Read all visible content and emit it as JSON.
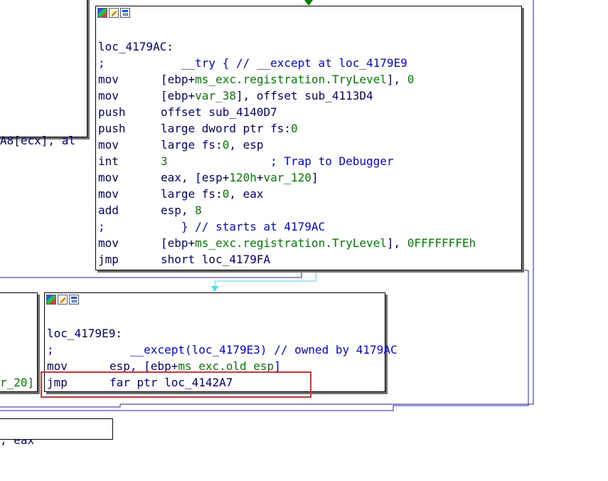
{
  "nodes": {
    "top": {
      "label": "loc_4179AC:",
      "lines": [
        {
          "mnem": ";",
          "ops": [
            {
              "t": "   __try { // __except at loc_4179E9",
              "c": "t-comment"
            }
          ]
        },
        {
          "mnem": "mov",
          "ops": [
            {
              "t": "[ebp+",
              "c": "t-plain"
            },
            {
              "t": "ms_exc.registration.TryLevel",
              "c": "t-var"
            },
            {
              "t": "], ",
              "c": "t-plain"
            },
            {
              "t": "0",
              "c": "t-num"
            }
          ]
        },
        {
          "mnem": "mov",
          "ops": [
            {
              "t": "[ebp+",
              "c": "t-plain"
            },
            {
              "t": "var_38",
              "c": "t-var"
            },
            {
              "t": "], offset sub_4113D4",
              "c": "t-plain"
            }
          ]
        },
        {
          "mnem": "push",
          "ops": [
            {
              "t": "offset sub_4140D7",
              "c": "t-plain"
            }
          ]
        },
        {
          "mnem": "push",
          "ops": [
            {
              "t": "large dword ptr fs:",
              "c": "t-plain"
            },
            {
              "t": "0",
              "c": "t-num"
            }
          ]
        },
        {
          "mnem": "mov",
          "ops": [
            {
              "t": "large fs:",
              "c": "t-plain"
            },
            {
              "t": "0",
              "c": "t-num"
            },
            {
              "t": ", esp",
              "c": "t-plain"
            }
          ]
        },
        {
          "mnem": "int",
          "ops": [
            {
              "t": "3",
              "c": "t-num"
            },
            {
              "t": "               ; Trap to Debugger",
              "c": "t-comment"
            }
          ]
        },
        {
          "mnem": "mov",
          "ops": [
            {
              "t": "eax, [esp+",
              "c": "t-plain"
            },
            {
              "t": "120h",
              "c": "t-num"
            },
            {
              "t": "+",
              "c": "t-plain"
            },
            {
              "t": "var_120",
              "c": "t-var"
            },
            {
              "t": "]",
              "c": "t-plain"
            }
          ]
        },
        {
          "mnem": "mov",
          "ops": [
            {
              "t": "large fs:",
              "c": "t-plain"
            },
            {
              "t": "0",
              "c": "t-num"
            },
            {
              "t": ", eax",
              "c": "t-plain"
            }
          ]
        },
        {
          "mnem": "add",
          "ops": [
            {
              "t": "esp, ",
              "c": "t-plain"
            },
            {
              "t": "8",
              "c": "t-num"
            }
          ]
        },
        {
          "mnem": ";",
          "ops": [
            {
              "t": "   } // starts at 4179AC",
              "c": "t-comment"
            }
          ]
        },
        {
          "mnem": "mov",
          "ops": [
            {
              "t": "[ebp+",
              "c": "t-plain"
            },
            {
              "t": "ms_exc.registration.TryLevel",
              "c": "t-var"
            },
            {
              "t": "], ",
              "c": "t-plain"
            },
            {
              "t": "0FFFFFFFEh",
              "c": "t-num"
            }
          ]
        },
        {
          "mnem": "jmp",
          "ops": [
            {
              "t": "short loc_4179FA",
              "c": "t-plain"
            }
          ]
        }
      ]
    },
    "bottom": {
      "label": "loc_4179E9:",
      "lines": [
        {
          "mnem": ";",
          "ops": [
            {
              "t": "   __except(loc_4179E3) // owned by 4179AC",
              "c": "t-comment"
            }
          ]
        },
        {
          "mnem": "mov",
          "ops": [
            {
              "t": "esp, [ebp+",
              "c": "t-plain"
            },
            {
              "t": "ms_exc.old_esp",
              "c": "t-var"
            },
            {
              "t": "]",
              "c": "t-plain"
            }
          ]
        },
        {
          "mnem": "jmp",
          "ops": [
            {
              "t": "far ptr loc_4142A7",
              "c": "t-plain"
            }
          ]
        }
      ]
    },
    "left_top": {
      "lines": [
        {
          "ops": [
            {
              "t": "A8[ecx], al",
              "c": "t-plain"
            }
          ]
        }
      ]
    },
    "left_bottom": {
      "lines": [
        {
          "ops": [
            {
              "t": "r_20]",
              "c": "t-var"
            }
          ]
        },
        {
          "ops": [
            {
              "t": ", eax",
              "c": "t-plain"
            }
          ]
        }
      ]
    }
  },
  "colors": {
    "highlight": "#e03030",
    "edge_blue": "#2020c0",
    "edge_cyan": "#40e0f0",
    "edge_green": "#008000"
  }
}
